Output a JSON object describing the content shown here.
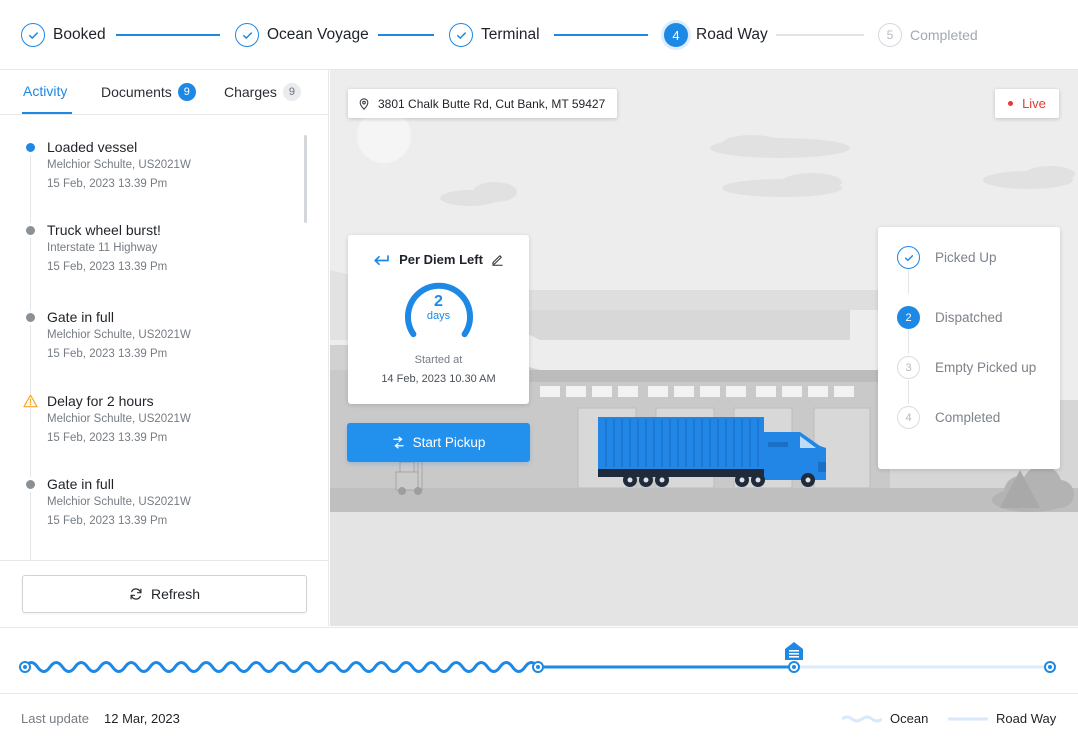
{
  "stepper": {
    "steps": [
      {
        "label": "Booked",
        "state": "done"
      },
      {
        "label": "Ocean Voyage",
        "state": "done"
      },
      {
        "label": "Terminal",
        "state": "done"
      },
      {
        "label": "Road Way",
        "number": "4",
        "state": "active"
      },
      {
        "label": "Completed",
        "number": "5",
        "state": "future"
      }
    ]
  },
  "tabs": [
    {
      "label": "Activity",
      "selected": true
    },
    {
      "label": "Documents",
      "count": "9"
    },
    {
      "label": "Charges",
      "count": "9"
    }
  ],
  "activity": [
    {
      "title": "Loaded vessel",
      "sub": "Melchior Schulte, US2021W",
      "time": "15 Feb, 2023  13.39 Pm",
      "marker": "blue-dot"
    },
    {
      "title": "Truck wheel burst!",
      "sub": "Interstate 11 Highway",
      "time": "15 Feb, 2023  13.39 Pm",
      "marker": "grey-dot"
    },
    {
      "title": "Gate in full",
      "sub": "Melchior Schulte, US2021W",
      "time": "15 Feb, 2023  13.39 Pm",
      "marker": "grey-dot"
    },
    {
      "title": "Delay for 2 hours",
      "sub": "Melchior Schulte, US2021W",
      "time": "15 Feb, 2023  13.39 Pm",
      "marker": "warning-icon"
    },
    {
      "title": "Gate in full",
      "sub": "Melchior Schulte, US2021W",
      "time": "15 Feb, 2023  13.39 Pm",
      "marker": "grey-dot"
    }
  ],
  "refresh_label": "Refresh",
  "map": {
    "address": "3801 Chalk Butte Rd, Cut Bank, MT 59427",
    "live_label": "Live"
  },
  "per_diem": {
    "title": "Per Diem Left",
    "days_value": "2",
    "days_unit": "days",
    "started_label": "Started at",
    "started_date": "14 Feb, 2023 10.30 AM"
  },
  "start_pickup_label": "Start Pickup",
  "status_list": [
    {
      "label": "Picked Up",
      "state": "done"
    },
    {
      "label": "Dispatched",
      "number": "2",
      "state": "current"
    },
    {
      "label": "Empty Picked up",
      "number": "3",
      "state": "future"
    },
    {
      "label": "Completed",
      "number": "4",
      "state": "future"
    }
  ],
  "footer": {
    "last_update_label": "Last update",
    "last_update_value": "12 Mar, 2023",
    "legend_ocean": "Ocean",
    "legend_road": "Road Way"
  },
  "colors": {
    "accent": "#1e88e5",
    "live": "#e53935",
    "warning": "#f5a623"
  }
}
